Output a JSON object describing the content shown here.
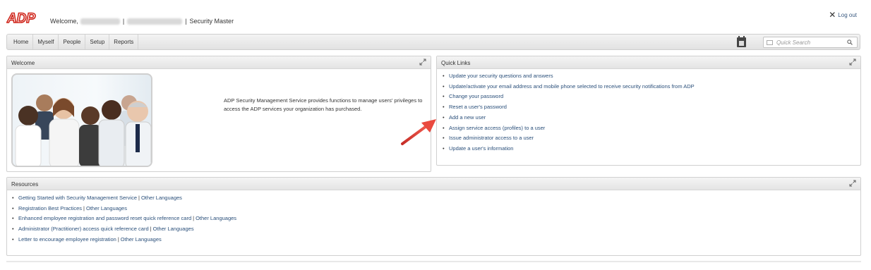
{
  "header": {
    "logo_text": "ADP",
    "welcome_label": "Welcome,",
    "separator": "|",
    "app_name": "Security Master",
    "logout_label": "Log out"
  },
  "nav": {
    "items": [
      "Home",
      "Myself",
      "People",
      "Setup",
      "Reports"
    ]
  },
  "search": {
    "placeholder": "Quick Search"
  },
  "welcome_panel": {
    "title": "Welcome",
    "description": "ADP Security Management Service provides functions to manage users' privileges to access the ADP services your organization has purchased."
  },
  "quick_links": {
    "title": "Quick Links",
    "items": [
      "Update your security questions and answers",
      "Update/activate your email address and mobile phone selected to receive security notifications from ADP",
      "Change your password",
      "Reset a user's password",
      "Add a new user",
      "Assign service access (profiles) to a user",
      "Issue administrator access to a user",
      "Update a user's information"
    ]
  },
  "resources": {
    "title": "Resources",
    "other_languages": "Other Languages",
    "items": [
      "Getting Started with Security Management Service",
      "Registration Best Practices",
      "Enhanced employee registration and password reset quick reference card",
      "Administrator (Practitioner) access quick reference card",
      "Letter to encourage employee registration"
    ]
  },
  "colors": {
    "brand_red": "#d0271d",
    "link_blue": "#2a4f7a",
    "annotation_arrow": "#e0403a"
  }
}
